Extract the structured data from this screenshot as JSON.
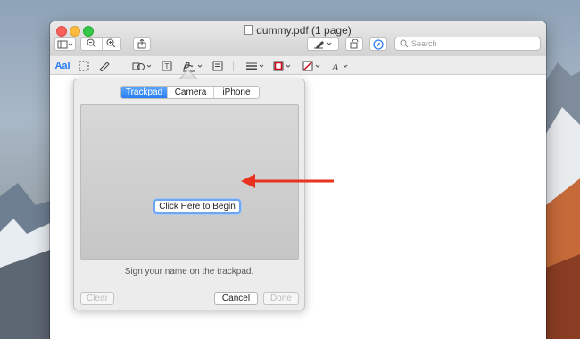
{
  "window": {
    "title": "dummy.pdf (1 page)"
  },
  "toolbar": {
    "search_placeholder": "Search"
  },
  "markup": {
    "text_tool_label": "AaI"
  },
  "signature": {
    "tabs": [
      {
        "label": "Trackpad",
        "active": true
      },
      {
        "label": "Camera",
        "active": false
      },
      {
        "label": "iPhone",
        "active": false
      }
    ],
    "begin_label": "Click Here to Begin",
    "hint": "Sign your name on the trackpad.",
    "clear_label": "Clear",
    "cancel_label": "Cancel",
    "done_label": "Done"
  },
  "colors": {
    "accent": "#2a7ef2",
    "annotation_arrow": "#e8321e"
  }
}
